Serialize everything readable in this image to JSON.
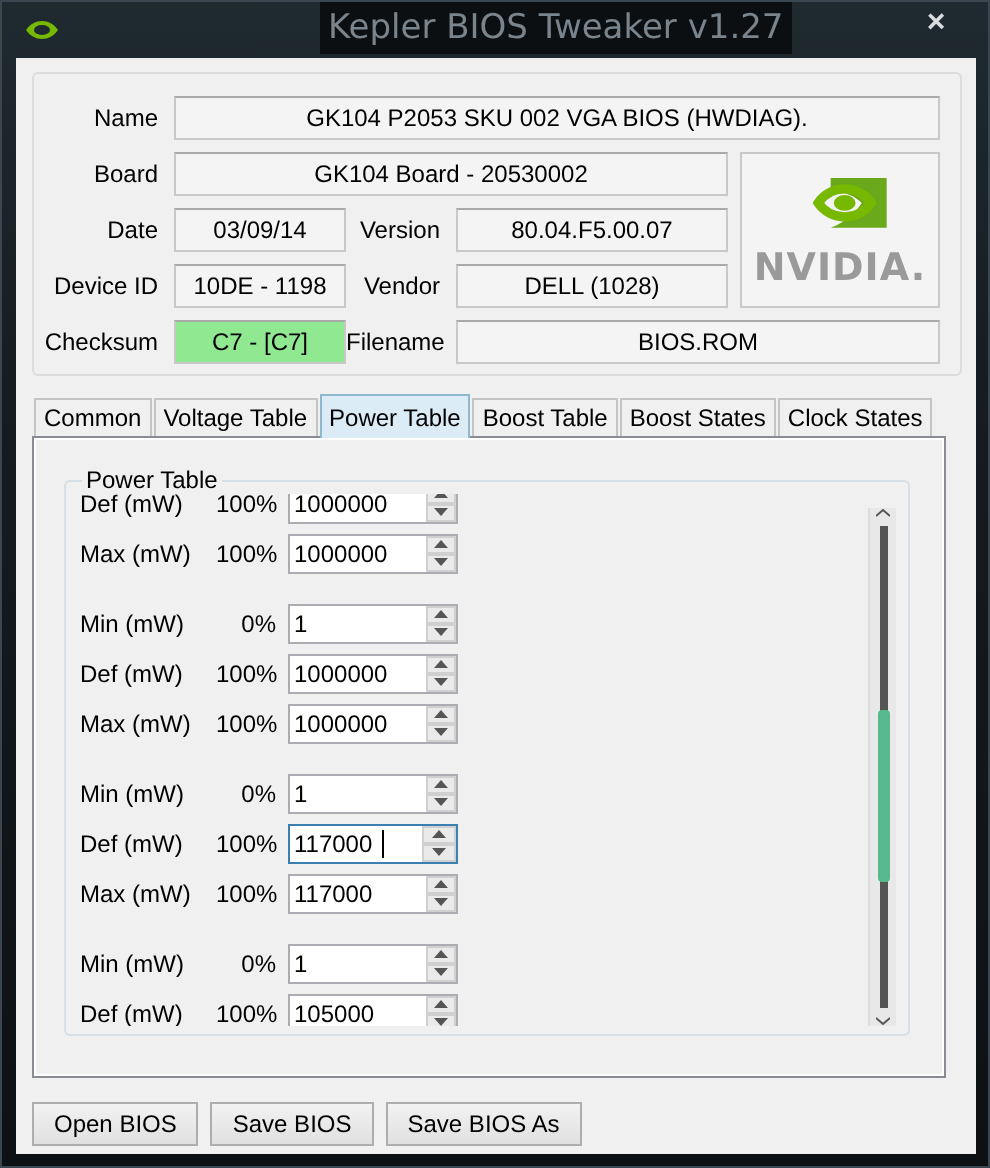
{
  "window": {
    "title": "Kepler BIOS Tweaker v1.27",
    "close": "×"
  },
  "info": {
    "name": {
      "label": "Name",
      "value": "GK104 P2053 SKU 002 VGA BIOS (HWDIAG)."
    },
    "board": {
      "label": "Board",
      "value": "GK104 Board - 20530002"
    },
    "date": {
      "label": "Date",
      "value": "03/09/14"
    },
    "version": {
      "label": "Version",
      "value": "80.04.F5.00.07"
    },
    "device_id": {
      "label": "Device ID",
      "value": "10DE - 1198"
    },
    "vendor": {
      "label": "Vendor",
      "value": "DELL (1028)"
    },
    "checksum": {
      "label": "Checksum",
      "value": "C7 - [C7]",
      "valid": true
    },
    "filename": {
      "label": "Filename",
      "value": "BIOS.ROM"
    },
    "logo": {
      "text": "NVIDIA."
    }
  },
  "tabs": [
    {
      "label": "Common",
      "selected": false
    },
    {
      "label": "Voltage Table",
      "selected": false
    },
    {
      "label": "Power Table",
      "selected": true
    },
    {
      "label": "Boost Table",
      "selected": false
    },
    {
      "label": "Boost States",
      "selected": false
    },
    {
      "label": "Clock States",
      "selected": false
    }
  ],
  "power_table": {
    "title": "Power Table",
    "groups": [
      {
        "entries": [
          {
            "label": "Def (mW)",
            "percent": "100%",
            "value": "1000000",
            "focused": false
          },
          {
            "label": "Max (mW)",
            "percent": "100%",
            "value": "1000000",
            "focused": false
          }
        ]
      },
      {
        "entries": [
          {
            "label": "Min (mW)",
            "percent": "0%",
            "value": "1",
            "focused": false
          },
          {
            "label": "Def (mW)",
            "percent": "100%",
            "value": "1000000",
            "focused": false
          },
          {
            "label": "Max (mW)",
            "percent": "100%",
            "value": "1000000",
            "focused": false
          }
        ]
      },
      {
        "entries": [
          {
            "label": "Min (mW)",
            "percent": "0%",
            "value": "1",
            "focused": false
          },
          {
            "label": "Def (mW)",
            "percent": "100%",
            "value": "117000",
            "focused": true
          },
          {
            "label": "Max (mW)",
            "percent": "100%",
            "value": "117000",
            "focused": false
          }
        ]
      },
      {
        "entries": [
          {
            "label": "Min (mW)",
            "percent": "0%",
            "value": "1",
            "focused": false
          },
          {
            "label": "Def (mW)",
            "percent": "100%",
            "value": "105000",
            "focused": false
          }
        ]
      }
    ]
  },
  "buttons": [
    "Open BIOS",
    "Save BIOS",
    "Save BIOS As"
  ]
}
